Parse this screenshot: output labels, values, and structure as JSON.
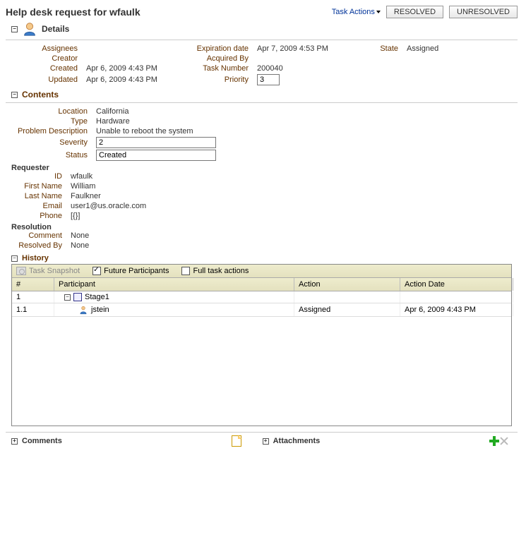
{
  "header": {
    "title": "Help desk request for wfaulk",
    "task_actions_label": "Task Actions",
    "resolved_btn": "RESOLVED",
    "unresolved_btn": "UNRESOLVED"
  },
  "sections": {
    "details_label": "Details",
    "contents_label": "Contents",
    "requester_label": "Requester",
    "resolution_label": "Resolution",
    "history_label": "History",
    "comments_label": "Comments",
    "attachments_label": "Attachments"
  },
  "details": {
    "labels": {
      "assignees": "Assignees",
      "creator": "Creator",
      "created": "Created",
      "updated": "Updated",
      "expiration": "Expiration date",
      "acquired_by": "Acquired By",
      "task_number": "Task Number",
      "priority": "Priority",
      "state": "State"
    },
    "assignees": "",
    "creator": "",
    "created": "Apr 6, 2009 4:43 PM",
    "updated": "Apr 6, 2009 4:43 PM",
    "expiration": "Apr 7, 2009 4:53 PM",
    "acquired_by": "",
    "task_number": "200040",
    "priority": "3",
    "state": "Assigned"
  },
  "contents": {
    "labels": {
      "location": "Location",
      "type": "Type",
      "problem_desc": "Problem Description",
      "severity": "Severity",
      "status": "Status"
    },
    "location": "California",
    "type": "Hardware",
    "problem_desc": "Unable to reboot the system",
    "severity": "2",
    "status": "Created"
  },
  "requester": {
    "labels": {
      "id": "ID",
      "first_name": "First Name",
      "last_name": "Last Name",
      "email": "Email",
      "phone": "Phone"
    },
    "id": "wfaulk",
    "first_name": "William",
    "last_name": "Faulkner",
    "email": "user1@us.oracle.com",
    "phone": "[{}]"
  },
  "resolution": {
    "labels": {
      "comment": "Comment",
      "resolved_by": "Resolved By"
    },
    "comment": "None",
    "resolved_by": "None"
  },
  "history": {
    "toolbar": {
      "task_snapshot": "Task Snapshot",
      "future_participants": "Future Participants",
      "full_task_actions": "Full task actions"
    },
    "columns": {
      "num": "#",
      "participant": "Participant",
      "action": "Action",
      "action_date": "Action Date"
    },
    "rows": [
      {
        "num": "1",
        "participant": "Stage1",
        "action": "",
        "action_date": "",
        "kind": "stage"
      },
      {
        "num": "1.1",
        "participant": "jstein",
        "action": "Assigned",
        "action_date": "Apr 6, 2009 4:43 PM",
        "kind": "user"
      }
    ]
  }
}
